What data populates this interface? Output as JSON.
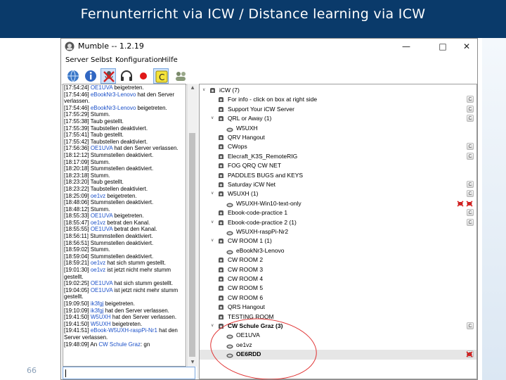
{
  "slide": {
    "title": "Fernunterricht via ICW / Distance learning via ICW",
    "number": "66",
    "colors": {
      "header": "#0a3a6a",
      "accent_red": "#e03030"
    }
  },
  "window": {
    "title": "Mumble -- 1.2.19",
    "controls": [
      "minimize-icon",
      "maximize-icon",
      "close-icon"
    ],
    "menu": [
      "Server",
      "Selbst",
      "Konfiguration",
      "Hilfe"
    ],
    "toolbar_icons": [
      "server-connect-icon",
      "info-icon",
      "microphone-muted-icon",
      "headphones-icon",
      "record-icon",
      "comment-icon",
      "users-icon"
    ]
  },
  "log": [
    [
      {
        "t": "[17:54:24] "
      },
      {
        "t": "OE1UVA",
        "b": 1
      },
      {
        "t": " beigetreten."
      }
    ],
    [
      {
        "t": "[17:54:46] "
      },
      {
        "t": "eBookNr3-Lenovo",
        "b": 1
      },
      {
        "t": " hat den Server verlassen."
      }
    ],
    [
      {
        "t": "[17:54:46] "
      },
      {
        "t": "eBookNr3-Lenovo",
        "b": 1
      },
      {
        "t": " beigetreten."
      }
    ],
    [
      {
        "t": "[17:55:29] Stumm."
      }
    ],
    [
      {
        "t": "[17:55:38] Taub gestellt."
      }
    ],
    [
      {
        "t": "[17:55:39] Taubstellen deaktiviert."
      }
    ],
    [
      {
        "t": "[17:55:41] Taub gestellt."
      }
    ],
    [
      {
        "t": "[17:55:42] Taubstellen deaktiviert."
      }
    ],
    [
      {
        "t": "[17:56:36] "
      },
      {
        "t": "OE1UVA",
        "b": 1
      },
      {
        "t": " hat den Server verlassen."
      }
    ],
    [
      {
        "t": "[18:12:12] Stummstellen deaktiviert."
      }
    ],
    [
      {
        "t": "[18:17:09] Stumm."
      }
    ],
    [
      {
        "t": "[18:20:18] Stummstellen deaktiviert."
      }
    ],
    [
      {
        "t": "[18:23:18] Stumm."
      }
    ],
    [
      {
        "t": "[18:23:20] Taub gestellt."
      }
    ],
    [
      {
        "t": "[18:23:22] Taubstellen deaktiviert."
      }
    ],
    [
      {
        "t": "[18:25:09] "
      },
      {
        "t": "oe1vz",
        "b": 1
      },
      {
        "t": " beigetreten."
      }
    ],
    [
      {
        "t": "[18:48:06] Stummstellen deaktiviert."
      }
    ],
    [
      {
        "t": "[18:48:12] Stumm."
      }
    ],
    [
      {
        "t": "[18:55:33] "
      },
      {
        "t": "OE1UVA",
        "b": 1
      },
      {
        "t": " beigetreten."
      }
    ],
    [
      {
        "t": "[18:55:47] "
      },
      {
        "t": "oe1vz",
        "b": 1
      },
      {
        "t": " betrat den Kanal."
      }
    ],
    [
      {
        "t": "[18:55:55] "
      },
      {
        "t": "OE1UVA",
        "b": 1
      },
      {
        "t": " betrat den Kanal."
      }
    ],
    [
      {
        "t": "[18:56:11] Stummstellen deaktiviert."
      }
    ],
    [
      {
        "t": "[18:56:51] Stummstellen deaktiviert."
      }
    ],
    [
      {
        "t": "[18:59:02] Stumm."
      }
    ],
    [
      {
        "t": "[18:59:04] Stummstellen deaktiviert."
      }
    ],
    [
      {
        "t": "[18:59:21] "
      },
      {
        "t": "oe1vz",
        "b": 1
      },
      {
        "t": " hat sich stumm gestellt."
      }
    ],
    [
      {
        "t": "[19:01:30] "
      },
      {
        "t": "oe1vz",
        "b": 1
      },
      {
        "t": " ist jetzt nicht mehr stumm gestellt."
      }
    ],
    [
      {
        "t": "[19:02:25] "
      },
      {
        "t": "OE1UVA",
        "b": 1
      },
      {
        "t": " hat sich stumm gestellt."
      }
    ],
    [
      {
        "t": "[19:04:05] "
      },
      {
        "t": "OE1UVA",
        "b": 1
      },
      {
        "t": " ist jetzt nicht mehr stumm gestellt."
      }
    ],
    [
      {
        "t": "[19:09:50] "
      },
      {
        "t": "ik3fgj",
        "b": 1
      },
      {
        "t": " beigetreten."
      }
    ],
    [
      {
        "t": "[19:10:09] "
      },
      {
        "t": "ik3fgj",
        "b": 1
      },
      {
        "t": " hat den Server verlassen."
      }
    ],
    [
      {
        "t": "[19:41:50] "
      },
      {
        "t": "W5UXH",
        "b": 1
      },
      {
        "t": " hat den Server verlassen."
      }
    ],
    [
      {
        "t": "[19:41:50] "
      },
      {
        "t": "W5UXH",
        "b": 1
      },
      {
        "t": " beigetreten."
      }
    ],
    [
      {
        "t": "[19:41:51] "
      },
      {
        "t": "eBook-W5UXH-raspPi-Nr1",
        "b": 1
      },
      {
        "t": " hat den Server verlassen."
      }
    ],
    [
      {
        "t": "[19:48:09] An "
      },
      {
        "t": "CW Schule Graz",
        "b": 1
      },
      {
        "t": ": gn"
      }
    ]
  ],
  "tree": [
    {
      "kind": "channel",
      "label": "iCW (7)",
      "level": 0,
      "expand": "collapse"
    },
    {
      "kind": "channel",
      "label": "For info - click on box at right side",
      "level": 1,
      "comment": true
    },
    {
      "kind": "channel",
      "label": "Support Your iCW Server",
      "level": 1,
      "comment": true
    },
    {
      "kind": "channel",
      "label": "QRL or Away (1)",
      "level": 1,
      "expand": "collapse",
      "comment": true
    },
    {
      "kind": "user",
      "label": "W5UXH",
      "level": 2
    },
    {
      "kind": "channel",
      "label": "QRV Hangout",
      "level": 1
    },
    {
      "kind": "channel",
      "label": "CWops",
      "level": 1,
      "comment": true
    },
    {
      "kind": "channel",
      "label": "Elecraft_K3S_RemoteRIG",
      "level": 1,
      "comment": true
    },
    {
      "kind": "channel",
      "label": "FOG QRQ CW NET",
      "level": 1
    },
    {
      "kind": "channel",
      "label": "PADDLES BUGS and KEYS",
      "level": 1
    },
    {
      "kind": "channel",
      "label": "Saturday iCW Net",
      "level": 1,
      "comment": true
    },
    {
      "kind": "channel",
      "label": "W5UXH (1)",
      "level": 1,
      "expand": "collapse",
      "comment": true
    },
    {
      "kind": "user",
      "label": "W5UXH-Win10-text-only",
      "level": 2,
      "muted": true
    },
    {
      "kind": "channel",
      "label": "Ebook-code-practice 1",
      "level": 1,
      "comment": true
    },
    {
      "kind": "channel",
      "label": "Ebook-code-practice 2 (1)",
      "level": 1,
      "expand": "collapse",
      "comment": true
    },
    {
      "kind": "user",
      "label": "W5UXH-raspPi-Nr2",
      "level": 2
    },
    {
      "kind": "channel",
      "label": "CW ROOM 1 (1)",
      "level": 1,
      "expand": "collapse"
    },
    {
      "kind": "user",
      "label": "eBookNr3-Lenovo",
      "level": 2
    },
    {
      "kind": "channel",
      "label": "CW ROOM 2",
      "level": 1
    },
    {
      "kind": "channel",
      "label": "CW ROOM 3",
      "level": 1
    },
    {
      "kind": "channel",
      "label": "CW ROOM 4",
      "level": 1
    },
    {
      "kind": "channel",
      "label": "CW ROOM 5",
      "level": 1
    },
    {
      "kind": "channel",
      "label": "CW ROOM 6",
      "level": 1
    },
    {
      "kind": "channel",
      "label": "QRS Hangout",
      "level": 1
    },
    {
      "kind": "channel",
      "label": "TESTING ROOM",
      "level": 1
    },
    {
      "kind": "channel",
      "label": "CW Schule Graz (3)",
      "level": 1,
      "expand": "collapse",
      "bold": true,
      "comment": true
    },
    {
      "kind": "user",
      "label": "OE1UVA",
      "level": 2
    },
    {
      "kind": "user",
      "label": "oe1vz",
      "level": 2
    },
    {
      "kind": "user",
      "label": "OE6RDD",
      "level": 2,
      "bold": true,
      "selected": true,
      "comment": true,
      "deaf": true
    }
  ]
}
